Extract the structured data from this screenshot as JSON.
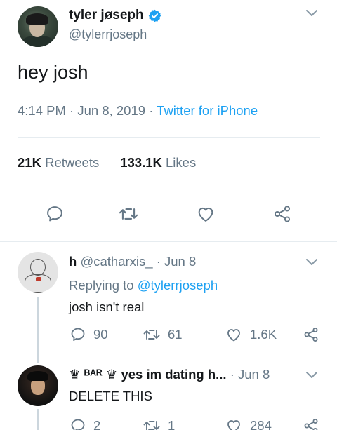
{
  "main_tweet": {
    "display_name": "tyler jøseph",
    "handle": "@tylerrjoseph",
    "text": "hey josh",
    "time": "4:14 PM",
    "date": "Jun 8, 2019",
    "source": "Twitter for iPhone",
    "retweets_count": "21K",
    "retweets_label": "Retweets",
    "likes_count": "133.1K",
    "likes_label": "Likes",
    "icons": [
      "reply-icon",
      "retweet-icon",
      "like-icon",
      "share-icon"
    ]
  },
  "replies": [
    {
      "display_name": "h",
      "handle": "@catharxis_",
      "date": "Jun 8",
      "replying_prefix": "Replying to",
      "replying_to": "@tylerrjoseph",
      "text": "josh isn't real",
      "reply_count": "90",
      "retweet_count": "61",
      "like_count": "1.6K"
    },
    {
      "display_name": "♛ ᴮᴬᴿ ♛ yes im dating h...",
      "date": "Jun 8",
      "text": "DELETE THIS",
      "reply_count": "2",
      "retweet_count": "1",
      "like_count": "284"
    }
  ],
  "colors": {
    "link": "#1da1f2",
    "muted": "#657786",
    "text": "#14171a",
    "divider": "#e6ecf0",
    "verified": "#1da1f2"
  }
}
